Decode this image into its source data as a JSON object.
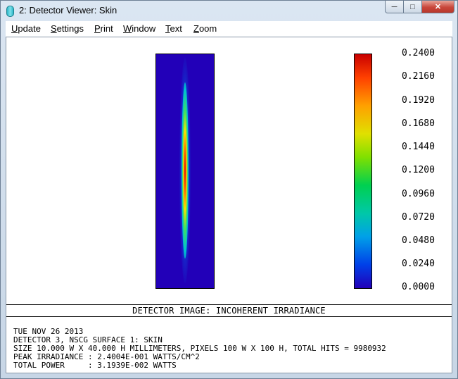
{
  "window": {
    "title": "2: Detector Viewer: Skin"
  },
  "menu": [
    {
      "label": "Update",
      "key": "U",
      "rest": "pdate"
    },
    {
      "label": "Settings",
      "key": "S",
      "rest": "ettings"
    },
    {
      "label": "Print",
      "key": "P",
      "rest": "rint"
    },
    {
      "label": "Window",
      "key": "W",
      "rest": "indow"
    },
    {
      "label": "Text",
      "key": "T",
      "rest": "ext"
    },
    {
      "label": "Zoom",
      "key": "Z",
      "rest": "oom"
    }
  ],
  "colorbar": {
    "labels": [
      "0.2400",
      "0.2160",
      "0.1920",
      "0.1680",
      "0.1440",
      "0.1200",
      "0.0960",
      "0.0720",
      "0.0480",
      "0.0240",
      "0.0000"
    ],
    "colors": [
      "#c80000",
      "#ff4000",
      "#ffa000",
      "#e0e000",
      "#80e000",
      "#00d050",
      "#00c8a8",
      "#00a0e8",
      "#0040e8",
      "#2200b8"
    ]
  },
  "caption": "DETECTOR IMAGE: INCOHERENT IRRADIANCE",
  "info": [
    "TUE NOV 26 2013",
    "DETECTOR 3, NSCG SURFACE 1: SKIN",
    "SIZE 10.000 W X 40.000 H MILLIMETERS, PIXELS 100 W X 100 H, TOTAL HITS = 9980932",
    "PEAK IRRADIANCE : 2.4004E-001 WATTS/CM^2",
    "TOTAL POWER     : 3.1939E-002 WATTS"
  ]
}
